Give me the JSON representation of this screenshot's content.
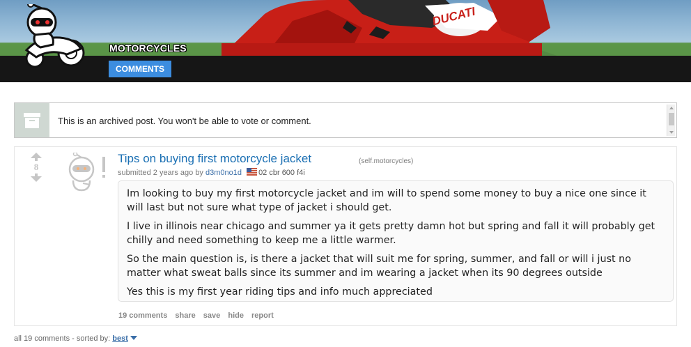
{
  "header": {
    "subreddit_name": "MOTORCYCLES",
    "active_tab": "COMMENTS",
    "banner_text": "DUCATI"
  },
  "archived_notice": {
    "message": "This is an archived post. You won't be able to vote or comment."
  },
  "post": {
    "score": "8",
    "title": "Tips on buying first motorcycle jacket",
    "domain": "(self.motorcycles)",
    "tagline": {
      "submitted": "submitted",
      "age": "2 years ago",
      "by": "by",
      "author": "d3m0no1d",
      "flair": "02 cbr 600 f4i"
    },
    "selftext": [
      "Im looking to buy my first motorcycle jacket and im will to spend some money to buy a nice one since it will last but not sure what type of jacket i should get.",
      "I live in illinois near chicago and summer ya it gets pretty damn hot but spring and fall it will probably get chilly and need something to keep me a little warmer.",
      "So the main question is, is there a jacket that will suit me for spring, summer, and fall or will i just no matter what sweat balls since its summer and im wearing a jacket when its 90 degrees outside",
      "Yes this is my first year riding tips and info much appreciated"
    ],
    "actions": {
      "comments": "19 comments",
      "share": "share",
      "save": "save",
      "hide": "hide",
      "report": "report"
    }
  },
  "sort": {
    "count_text": "all 19 comments",
    "separator": "-",
    "sorted_by": "sorted by:",
    "current": "best"
  },
  "colors": {
    "tab_active": "#3c8de0",
    "title_link": "#1a6fb3",
    "tabbar_bg": "#161616"
  }
}
